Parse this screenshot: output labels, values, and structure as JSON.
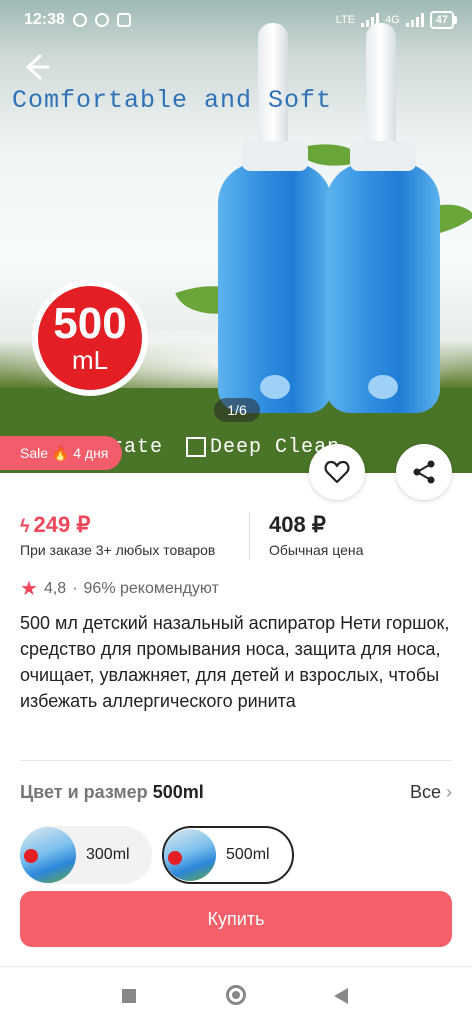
{
  "status_bar": {
    "time": "12:38",
    "network": "4G",
    "lte": "LTE",
    "battery": "47"
  },
  "hero": {
    "title": "Comfortable and Soft",
    "badge_value": "500",
    "badge_unit": "mL",
    "caption_left": "o operate",
    "caption_right": "Deep Clean",
    "counter": "1/6",
    "sale_label": "Sale 🔥 4 дня"
  },
  "pricing": {
    "sale_price": "249 ₽",
    "sale_note": "При заказе 3+ любых товаров",
    "regular_price": "408 ₽",
    "regular_note": "Обычная цена"
  },
  "rating": {
    "value": "4,8",
    "separator": "·",
    "recommend": "96% рекомендуют"
  },
  "description": "500 мл детский назальный аспиратор Нети горшок, средство для промывания носа, защита для носа, очищает, увлажняет, для детей и взрослых, чтобы избежать аллергического ринита",
  "options": {
    "label": "Цвет и размер",
    "selected": "500ml",
    "all_label": "Все",
    "chevron": "›",
    "chips": [
      {
        "label": "300ml",
        "selected": false
      },
      {
        "label": "500ml",
        "selected": true
      }
    ]
  },
  "buy_label": "Купить",
  "colors": {
    "accent": "#f45f69",
    "sale_price": "#f0485a",
    "star": "#f0485a"
  },
  "icons": [
    "back-arrow-icon",
    "heart-icon",
    "share-icon",
    "star-icon",
    "chevron-right-icon"
  ]
}
